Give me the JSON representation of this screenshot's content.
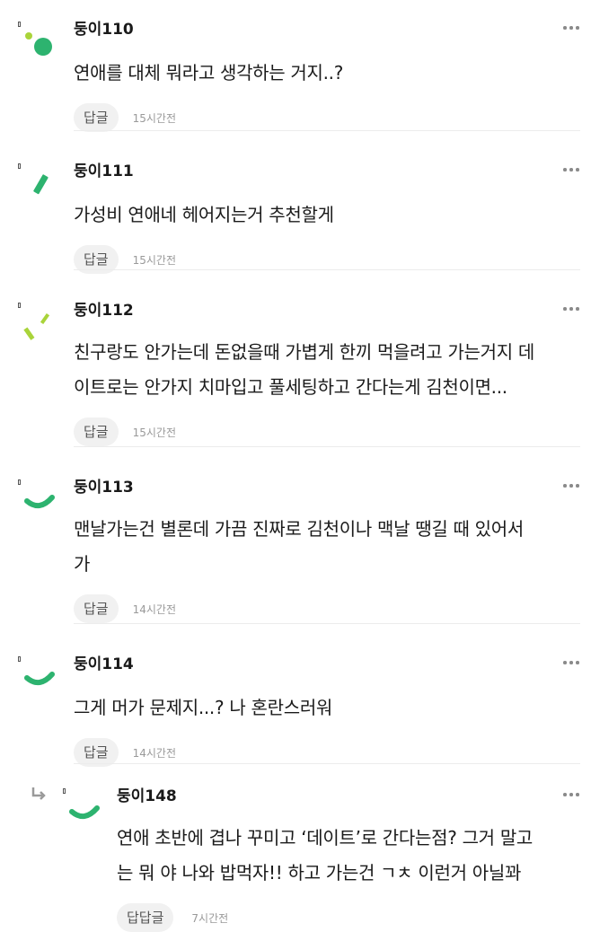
{
  "comments": [
    {
      "nickname": "둥이110",
      "lines": [
        "연애를 대체 뭐라고 생각하는 거지..?"
      ],
      "reply_label": "답글",
      "time": "15시간전"
    },
    {
      "nickname": "둥이111",
      "lines": [
        "가성비 연애네 헤어지는거 추천할게"
      ],
      "reply_label": "답글",
      "time": "15시간전"
    },
    {
      "nickname": "둥이112",
      "lines": [
        "친구랑도 안가는데 돈없을때 가볍게 한끼 먹을려고 가는거지 데",
        "이트로는 안가지 치마입고 풀세팅하고 간다는게 김천이면..."
      ],
      "reply_label": "답글",
      "time": "15시간전"
    },
    {
      "nickname": "둥이113",
      "lines": [
        "맨날가는건 별론데 가끔 진짜로 김천이나 맥날 땡길 때 있어서",
        "가"
      ],
      "reply_label": "답글",
      "time": "14시간전"
    },
    {
      "nickname": "둥이114",
      "lines": [
        "그게 머가 문제지...? 나 혼란스러워"
      ],
      "reply_label": "답글",
      "time": "14시간전"
    },
    {
      "nickname": "둥이148",
      "lines": [
        "연애 초반에 겹나 꾸미고 ‘데이트’로 간다는점? 그거 말고",
        "는 뭐 야 나와 밥먹자!! 하고 가는건 ㄱㅊ 이런거 아닐꽈"
      ],
      "reply_label": "답답글",
      "time": "7시간전"
    }
  ],
  "colors": {
    "avatar_green": "#2db36f",
    "avatar_lime": "#a9d43a",
    "text": "#1a1a1a",
    "time": "#9a9a9a",
    "reply_bg": "#f1f1f1"
  },
  "icons": {
    "more": "more-dots-icon",
    "reply_arrow": "reply-arrow-icon"
  }
}
